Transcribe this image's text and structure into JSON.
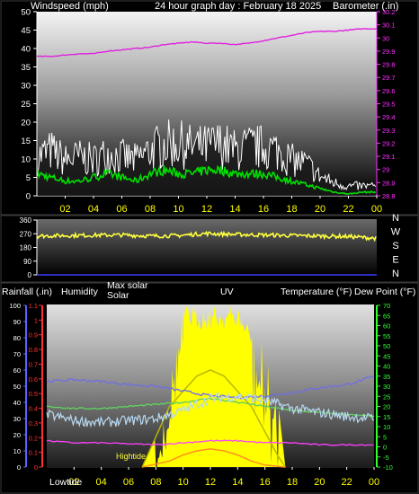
{
  "colors": {
    "bg": "#000000",
    "frame": "#3a3a3a",
    "gust": "#ffffff",
    "wind": "#00e000",
    "baro": "#e020e0",
    "dir": "#ffff40",
    "solar": "#ffff00",
    "maxsolar": "#b8b800",
    "uv": "#ff9020",
    "temp": "#b8d8f0",
    "dew": "#60d060",
    "humidity": "#7070e0",
    "hilo": "#ff40ff",
    "rain": "#ff2020",
    "white": "#ffffff",
    "yellow": "#ffff00",
    "leftaxis": "#ffffff",
    "rightaxis": "#ff30ff",
    "rainaxis": "#ff3030",
    "humaxis": "#6060ff",
    "tempaxis": "#30ff30"
  },
  "top": {
    "title_left": "Windspeed (mph)",
    "title_center": "24 hour graph day : February 18 2025",
    "title_right": "Barometer (.in)"
  },
  "mid": {
    "compass": [
      "N",
      "W",
      "S",
      "E",
      "N"
    ]
  },
  "bottom": {
    "label_rain": "Rainfall (.in)",
    "label_humidity": "Humidity",
    "label_maxsolar": "Max solar",
    "label_solar": "Solar",
    "label_uv": "UV",
    "label_temp": "Temperature (°F)",
    "label_dew": "Dew Point (°F)",
    "hightide": "Hightide",
    "lowtide": "Lowtide"
  },
  "chart_data": [
    {
      "type": "line",
      "x_ticks": [
        "02",
        "04",
        "06",
        "08",
        "10",
        "12",
        "14",
        "16",
        "18",
        "20",
        "22",
        "00"
      ],
      "y_left_ticks": [
        "0",
        "5",
        "10",
        "15",
        "20",
        "25",
        "30",
        "35",
        "40",
        "45",
        "50"
      ],
      "y_left_range": [
        0,
        50
      ],
      "y_right_ticks": [
        "28.8",
        "28.9",
        "29",
        "29.1",
        "29.2",
        "29.3",
        "29.4",
        "29.5",
        "29.6",
        "29.7",
        "29.8",
        "29.9",
        "30",
        "30.1",
        "30.2"
      ],
      "y_right_range": [
        28.8,
        30.2
      ],
      "series": [
        {
          "name": "Windspeed",
          "axis": "left",
          "x": [
            0,
            1,
            2,
            3,
            4,
            5,
            6,
            7,
            8,
            9,
            10,
            11,
            12,
            13,
            14,
            15,
            16,
            17,
            18,
            19,
            20,
            21,
            22,
            23,
            24
          ],
          "values": [
            6,
            5,
            4,
            4,
            5,
            6,
            5,
            4,
            6,
            7,
            6,
            6,
            7,
            7,
            6,
            6,
            6,
            5,
            4,
            3,
            2,
            1,
            0.5,
            1,
            1
          ]
        },
        {
          "name": "Gust",
          "axis": "left",
          "x": [
            0,
            1,
            2,
            3,
            4,
            5,
            6,
            7,
            8,
            9,
            10,
            11,
            12,
            13,
            14,
            15,
            16,
            17,
            18,
            19,
            20,
            21,
            22,
            23,
            24
          ],
          "values": [
            12,
            14,
            11,
            12,
            11,
            13,
            12,
            11,
            14,
            16,
            16,
            15,
            15,
            16,
            14,
            15,
            15,
            14,
            11,
            10,
            6,
            4,
            3,
            3,
            3
          ]
        },
        {
          "name": "Barometer",
          "axis": "right",
          "x": [
            0,
            1,
            2,
            3,
            4,
            5,
            6,
            7,
            8,
            9,
            10,
            11,
            12,
            13,
            14,
            15,
            16,
            17,
            18,
            19,
            20,
            21,
            22,
            23,
            24
          ],
          "values": [
            29.86,
            29.86,
            29.87,
            29.88,
            29.88,
            29.9,
            29.91,
            29.92,
            29.93,
            29.95,
            29.96,
            29.97,
            29.96,
            29.96,
            29.95,
            29.96,
            29.98,
            30.0,
            30.02,
            30.04,
            30.05,
            30.05,
            30.06,
            30.07,
            30.07
          ]
        }
      ]
    },
    {
      "type": "line",
      "y_ticks": [
        "0",
        "90",
        "180",
        "270",
        "360"
      ],
      "y_range": [
        0,
        360
      ],
      "series": [
        {
          "name": "Wind direction",
          "x": [
            0,
            2,
            4,
            6,
            8,
            10,
            12,
            14,
            16,
            18,
            20,
            22,
            24
          ],
          "values": [
            255,
            258,
            260,
            262,
            255,
            258,
            272,
            265,
            262,
            258,
            255,
            252,
            240
          ]
        }
      ]
    },
    {
      "type": "line",
      "x_ticks": [
        "02",
        "04",
        "06",
        "08",
        "10",
        "12",
        "14",
        "16",
        "18",
        "20",
        "22",
        "00"
      ],
      "y_rain_ticks": [
        "0",
        "0.1",
        "0.2",
        "0.3",
        "0.4",
        "0.5",
        "0.6",
        "0.7",
        "0.8",
        "0.9",
        "1",
        "1.1"
      ],
      "y_rain_range": [
        0,
        1.1
      ],
      "y_humidity_ticks": [
        "0",
        "10",
        "20",
        "30",
        "40",
        "50",
        "60",
        "70",
        "80",
        "90",
        "100"
      ],
      "y_humidity_range": [
        0,
        100
      ],
      "y_temp_ticks": [
        "-10",
        "-5",
        "0",
        "5",
        "10",
        "15",
        "20",
        "25",
        "30",
        "35",
        "40",
        "45",
        "50",
        "55",
        "60",
        "65",
        "70"
      ],
      "y_temp_range": [
        -10,
        70
      ],
      "series": [
        {
          "name": "Humidity",
          "axis": "humidity",
          "x": [
            0,
            2,
            4,
            6,
            8,
            10,
            12,
            14,
            16,
            18,
            20,
            22,
            24
          ],
          "values": [
            53,
            54,
            53,
            51,
            50,
            47,
            44,
            43,
            44,
            46,
            49,
            51,
            56
          ]
        },
        {
          "name": "Temperature",
          "axis": "temp",
          "x": [
            0,
            2,
            4,
            6,
            8,
            10,
            12,
            14,
            16,
            18,
            20,
            22,
            24
          ],
          "values": [
            16,
            13,
            12,
            13,
            14,
            18,
            24,
            25,
            23,
            19,
            17,
            15,
            14
          ]
        },
        {
          "name": "Dew Point",
          "axis": "temp",
          "x": [
            0,
            2,
            4,
            6,
            8,
            10,
            12,
            14,
            16,
            18,
            20,
            22,
            24
          ],
          "values": [
            20,
            19,
            19,
            20,
            21,
            22,
            24,
            22,
            20,
            18,
            17,
            16,
            15
          ]
        },
        {
          "name": "Hightide",
          "axis": "temp",
          "x": [
            0,
            2,
            4,
            6,
            8,
            10,
            12,
            14,
            16,
            18,
            20,
            22,
            24
          ],
          "values": [
            3,
            2,
            2,
            1.5,
            1,
            2,
            3,
            3,
            2,
            2,
            1,
            1,
            1
          ]
        },
        {
          "name": "Solar",
          "axis": "temp",
          "x": [
            0,
            7,
            8,
            9,
            10,
            11,
            12,
            13,
            14,
            15,
            16,
            17,
            17.5,
            24
          ],
          "values": [
            -10,
            -10,
            5,
            35,
            70,
            70,
            70,
            70,
            70,
            60,
            50,
            20,
            -10,
            -10
          ]
        },
        {
          "name": "Max solar",
          "axis": "temp",
          "x": [
            7,
            9,
            11,
            12,
            13,
            15,
            17,
            17.5
          ],
          "values": [
            -10,
            20,
            35,
            38,
            35,
            20,
            -5,
            -10
          ]
        },
        {
          "name": "UV",
          "axis": "temp",
          "x": [
            7,
            9,
            10,
            11,
            12,
            13,
            14,
            15,
            16,
            17.5
          ],
          "values": [
            -10,
            -7,
            -4,
            -2,
            -1,
            -2,
            -4,
            -7,
            -9,
            -10
          ]
        }
      ]
    }
  ]
}
